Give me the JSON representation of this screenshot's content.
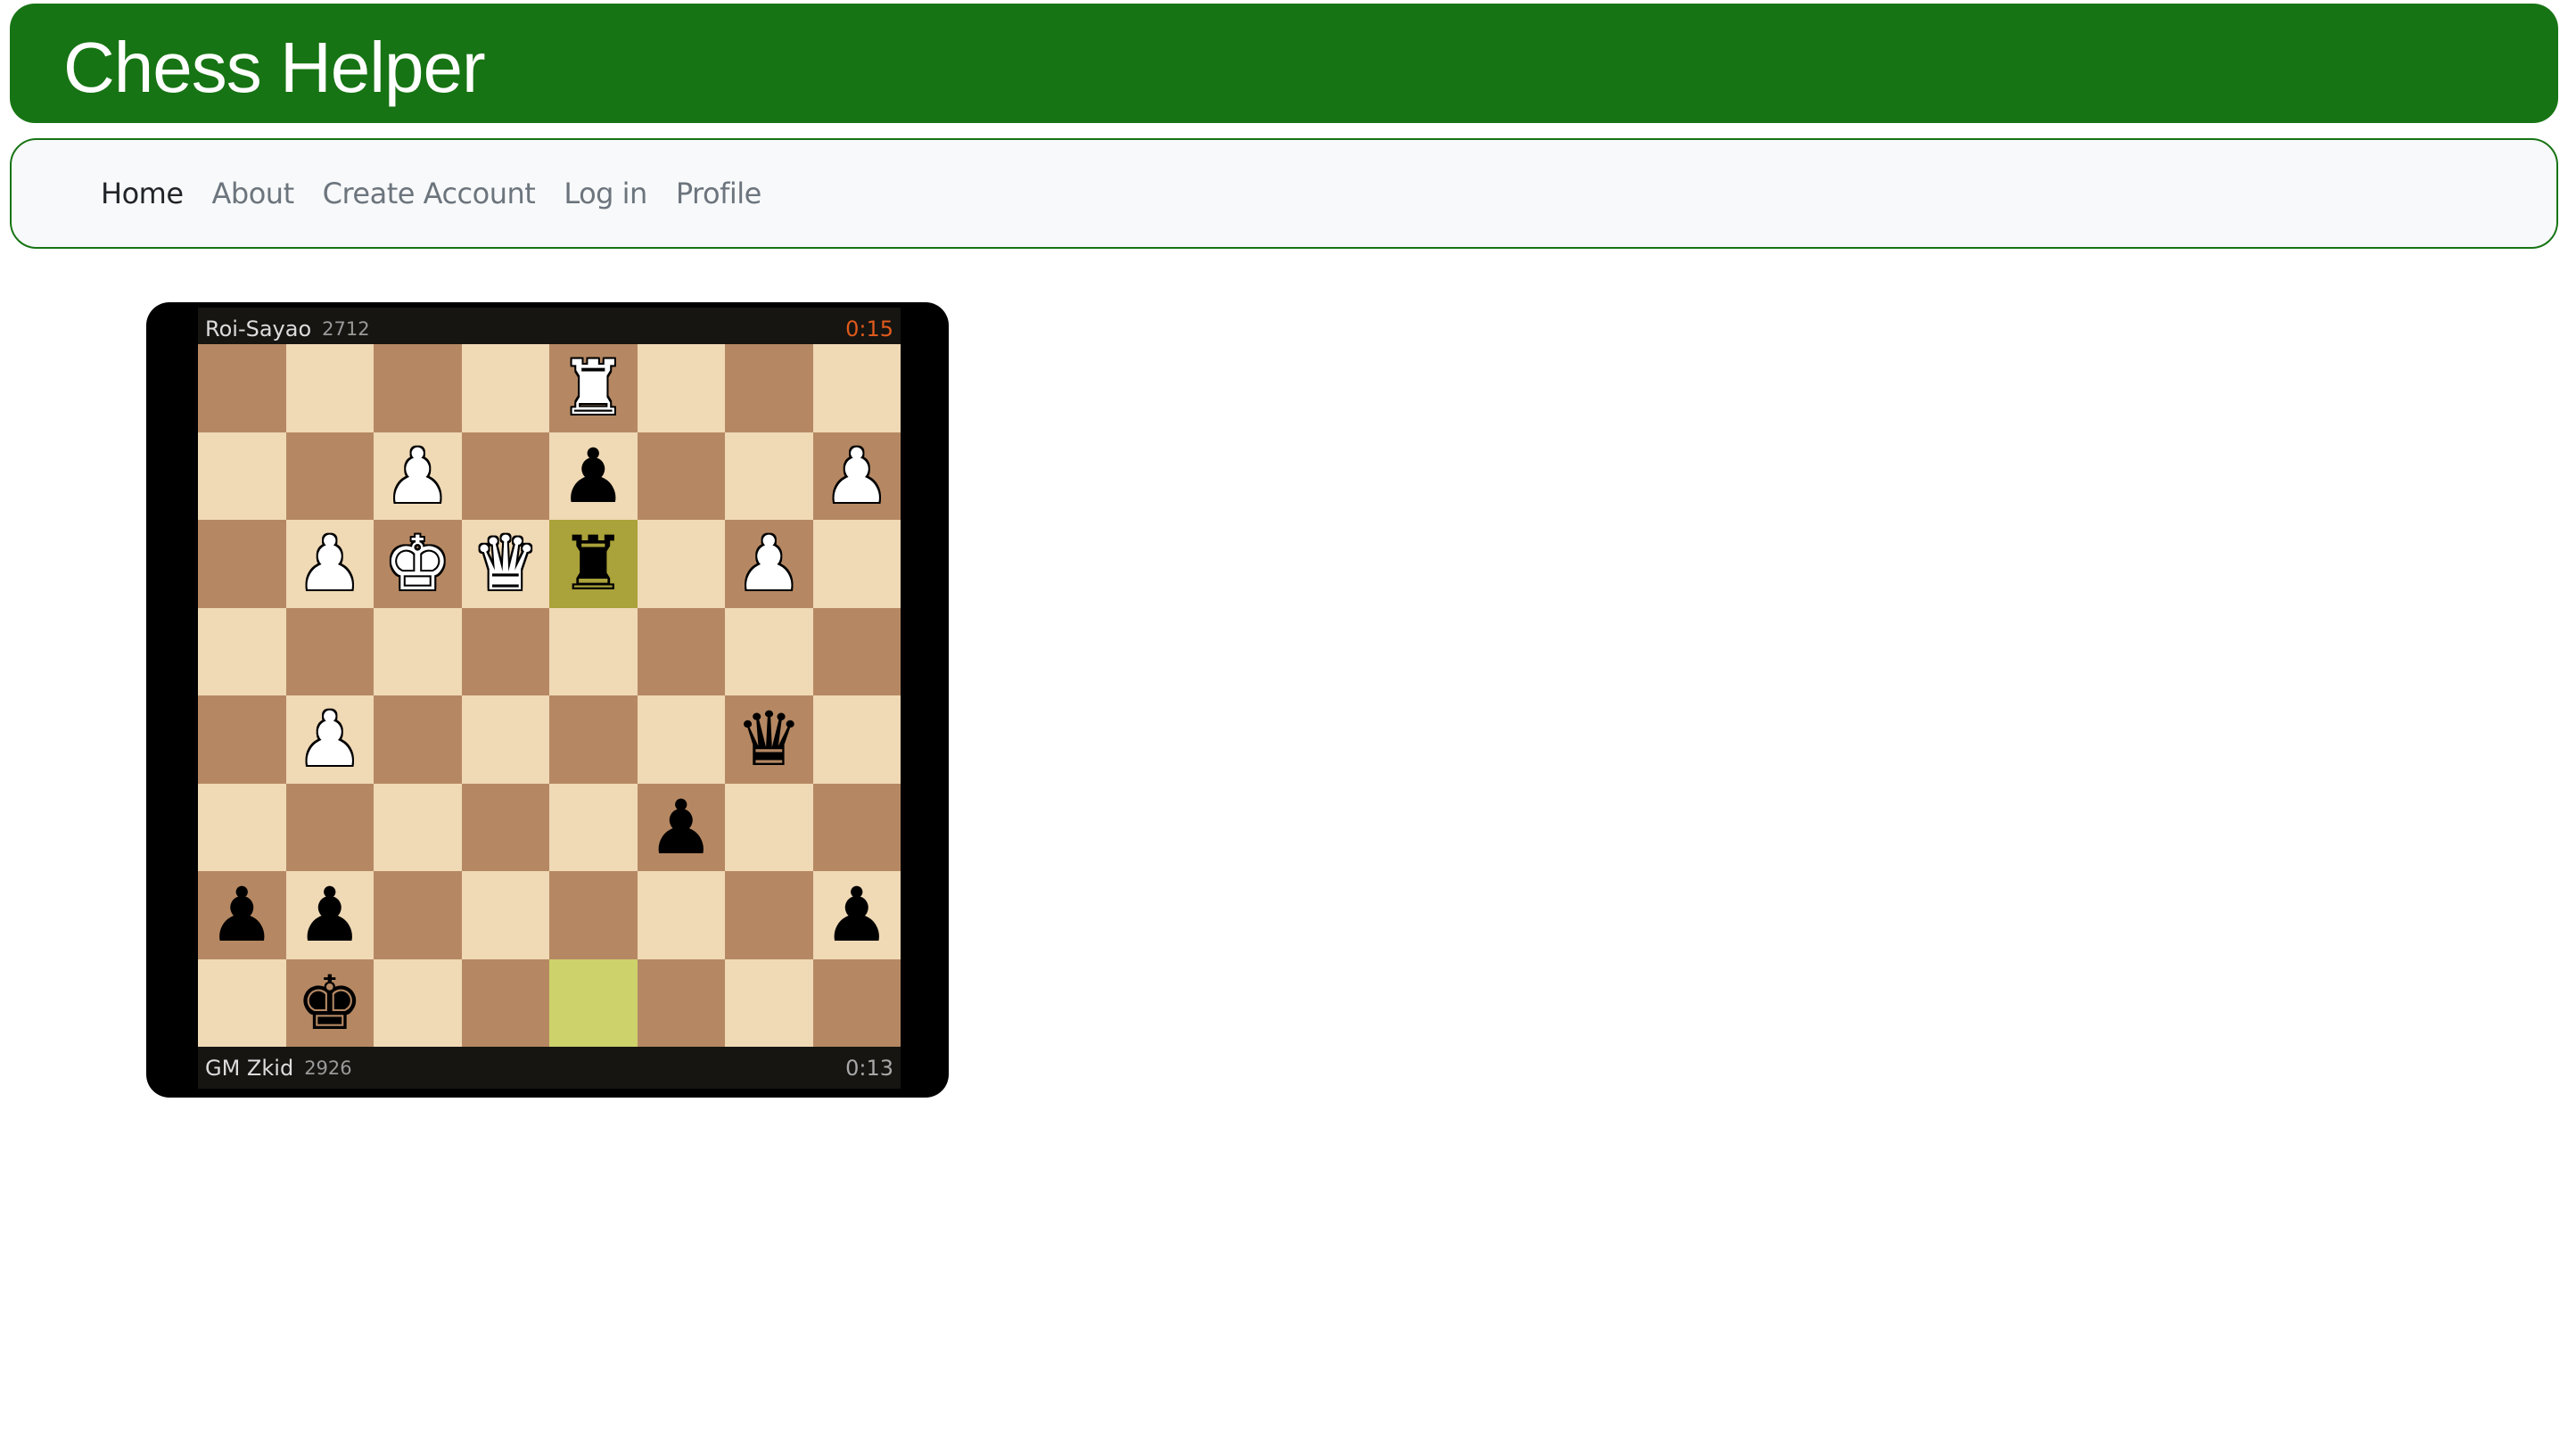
{
  "header": {
    "title": "Chess Helper"
  },
  "nav": {
    "items": [
      {
        "label": "Home",
        "active": true
      },
      {
        "label": "About",
        "active": false
      },
      {
        "label": "Create Account",
        "active": false
      },
      {
        "label": "Log in",
        "active": false
      },
      {
        "label": "Profile",
        "active": false
      }
    ]
  },
  "game": {
    "top_player": {
      "name": "Roi-Sayao",
      "rating": "2712",
      "clock": "0:15"
    },
    "bottom_player": {
      "name": "GM Zkid",
      "rating": "2926",
      "clock": "0:13"
    },
    "highlighted_squares": [
      "e6",
      "e1"
    ],
    "pieces": [
      {
        "square": "e8",
        "color": "white",
        "type": "rook"
      },
      {
        "square": "c7",
        "color": "white",
        "type": "pawn"
      },
      {
        "square": "e7",
        "color": "black",
        "type": "pawn"
      },
      {
        "square": "h7",
        "color": "white",
        "type": "pawn"
      },
      {
        "square": "b6",
        "color": "white",
        "type": "pawn"
      },
      {
        "square": "c6",
        "color": "white",
        "type": "king"
      },
      {
        "square": "d6",
        "color": "white",
        "type": "queen"
      },
      {
        "square": "e6",
        "color": "black",
        "type": "rook"
      },
      {
        "square": "g6",
        "color": "white",
        "type": "pawn"
      },
      {
        "square": "b4",
        "color": "white",
        "type": "pawn"
      },
      {
        "square": "g4",
        "color": "black",
        "type": "queen"
      },
      {
        "square": "f3",
        "color": "black",
        "type": "pawn"
      },
      {
        "square": "a2",
        "color": "black",
        "type": "pawn"
      },
      {
        "square": "b2",
        "color": "black",
        "type": "pawn"
      },
      {
        "square": "h2",
        "color": "black",
        "type": "pawn"
      },
      {
        "square": "b1",
        "color": "black",
        "type": "king"
      }
    ]
  }
}
